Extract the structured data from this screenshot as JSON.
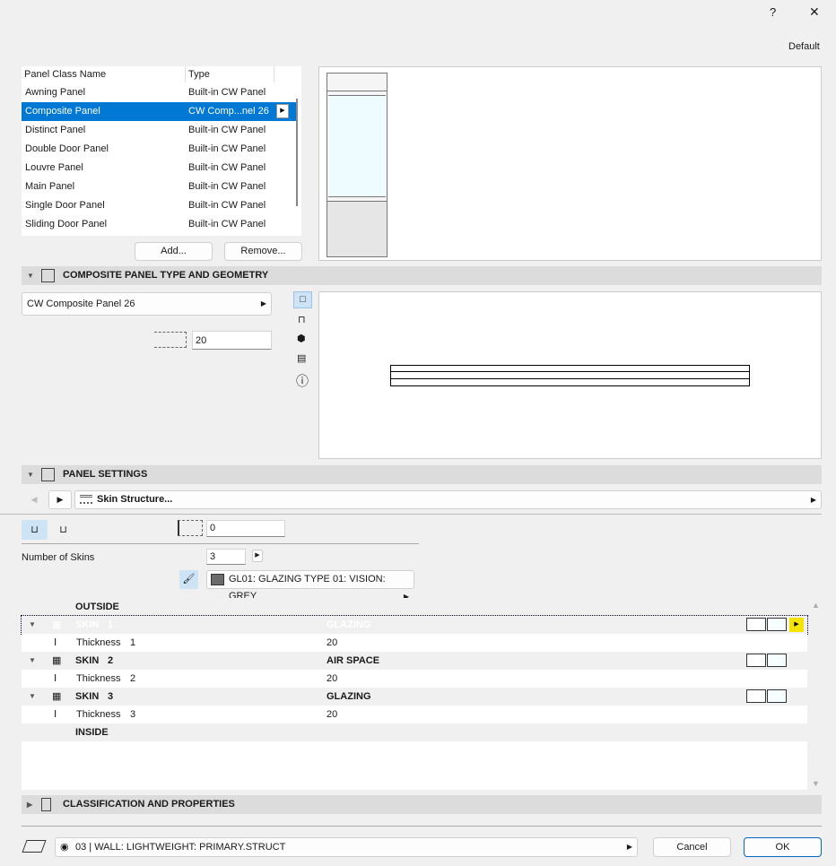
{
  "titlebar": {
    "help": "?",
    "close": "✕"
  },
  "favorite": "Default",
  "panel_table": {
    "headers": [
      "Panel Class Name",
      "Type"
    ],
    "rows": [
      {
        "name": "Awning Panel",
        "type": "Built-in CW Panel"
      },
      {
        "name": "Composite Panel",
        "type": "CW Comp...nel 26",
        "selected": true
      },
      {
        "name": "Distinct Panel",
        "type": "Built-in CW Panel"
      },
      {
        "name": "Double Door Panel",
        "type": "Built-in CW Panel"
      },
      {
        "name": "Louvre Panel",
        "type": "Built-in CW Panel"
      },
      {
        "name": "Main Panel",
        "type": "Built-in CW Panel"
      },
      {
        "name": "Single Door Panel",
        "type": "Built-in CW Panel"
      },
      {
        "name": "Sliding Door Panel",
        "type": "Built-in CW Panel"
      }
    ],
    "add": "Add...",
    "remove": "Remove..."
  },
  "geometry": {
    "title": "COMPOSITE PANEL TYPE AND GEOMETRY",
    "type_value": "CW Composite Panel 26",
    "thickness": "20"
  },
  "panel_settings": {
    "title": "PANEL SETTINGS",
    "page": "Skin Structure...",
    "offset": "0",
    "num_skins_label": "Number of Skins",
    "num_skins": "3",
    "surface": "GL01: GLAZING TYPE 01: VISION: GREY",
    "surface_color": "#6b6b6b"
  },
  "skins": {
    "outside": "OUTSIDE",
    "inside": "INSIDE",
    "items": [
      {
        "label": "SKIN",
        "num": "1",
        "material": "GLAZING",
        "thickness_label": "Thickness",
        "thickness": "20"
      },
      {
        "label": "SKIN",
        "num": "2",
        "material": "AIR SPACE",
        "thickness_label": "Thickness",
        "thickness": "20"
      },
      {
        "label": "SKIN",
        "num": "3",
        "material": "GLAZING",
        "thickness_label": "Thickness",
        "thickness": "20"
      }
    ]
  },
  "classification": {
    "title": "CLASSIFICATION AND PROPERTIES"
  },
  "footer": {
    "layer": "03 | WALL: LIGHTWEIGHT: PRIMARY.STRUCT",
    "cancel": "Cancel",
    "ok": "OK"
  },
  "colors": {
    "accent": "#0078d4",
    "section": "#dcdcdc"
  }
}
